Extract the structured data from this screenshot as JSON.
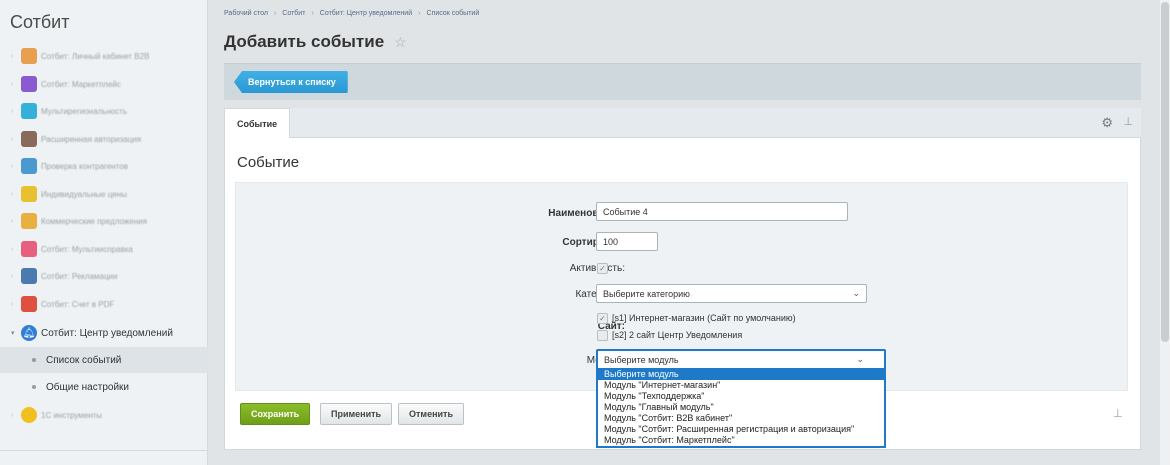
{
  "sidebar": {
    "title": "Сотбит",
    "items": [
      {
        "label": "Сотбит: Личный кабинет B2B",
        "icon": "b2b-icon",
        "color": "#e8a050"
      },
      {
        "label": "Сотбит: Маркетплейс",
        "icon": "marketplace-icon",
        "color": "#8a5ad0"
      },
      {
        "label": "Мультирегиональность",
        "icon": "location-pin-icon",
        "color": "#35b0d8"
      },
      {
        "label": "Расширенная авторизация",
        "icon": "auth-icon",
        "color": "#8a6a5a"
      },
      {
        "label": "Проверка контрагентов",
        "icon": "check-icon",
        "color": "#4a9ad0"
      },
      {
        "label": "Индивидуальные цены",
        "icon": "price-icon",
        "color": "#e8c030"
      },
      {
        "label": "Коммерческие предложения",
        "icon": "offer-icon",
        "color": "#e8b040"
      },
      {
        "label": "Сотбит: Мультиисправка",
        "icon": "multi-icon",
        "color": "#e86080"
      },
      {
        "label": "Сотбит: Рекламации",
        "icon": "claims-icon",
        "color": "#4a7ab0"
      },
      {
        "label": "Сотбит: Счет в PDF",
        "icon": "pdf-icon",
        "color": "#e05040"
      }
    ],
    "current_section": {
      "label": "Сотбит: Центр уведомлений",
      "icon": "bell-icon",
      "color": "#2e7ed8"
    },
    "sub_items": [
      {
        "label": "Список событий",
        "active": true
      },
      {
        "label": "Общие настройки",
        "active": false
      }
    ],
    "last_item": {
      "label": "1С инструменты",
      "icon": "1c-icon",
      "color": "#f0c020"
    }
  },
  "breadcrumb": [
    "Рабочий стол",
    "Сотбит",
    "Сотбит: Центр уведомлений",
    "Список событий"
  ],
  "page_title": "Добавить событие",
  "toolbar": {
    "back_label": "Вернуться к списку"
  },
  "tabs": [
    {
      "label": "Событие"
    }
  ],
  "section_title": "Событие",
  "form": {
    "name_label": "Наименование:",
    "name_value": "Событие 4",
    "sort_label": "Сортировка:",
    "sort_value": "100",
    "active_label": "Активность:",
    "active_checked": true,
    "category_label": "Категория:",
    "category_value": "Выберите категорию",
    "site_label": "Сайт:",
    "sites": [
      {
        "label": "[s1] Интернет-магазин (Сайт по умолчанию)",
        "checked": true
      },
      {
        "label": "[s2] 2 сайт Центр Уведомления",
        "checked": false
      }
    ],
    "module_label": "Модуль:",
    "module_value": "Выберите модуль",
    "module_options": [
      "Выберите модуль",
      "Модуль \"Интернет-магазин\"",
      "Модуль \"Техподдержка\"",
      "Модуль \"Главный модуль\"",
      "Модуль \"Сотбит: B2B кабинет\"",
      "Модуль \"Сотбит: Расширенная регистрация и авторизация\"",
      "Модуль \"Сотбит: Маркетплейс\""
    ]
  },
  "buttons": {
    "save": "Сохранить",
    "apply": "Применить",
    "cancel": "Отменить"
  },
  "colors": {
    "accent_blue": "#2a98d2",
    "save_green": "#7aad20",
    "focus_blue": "#1e7ac8"
  }
}
